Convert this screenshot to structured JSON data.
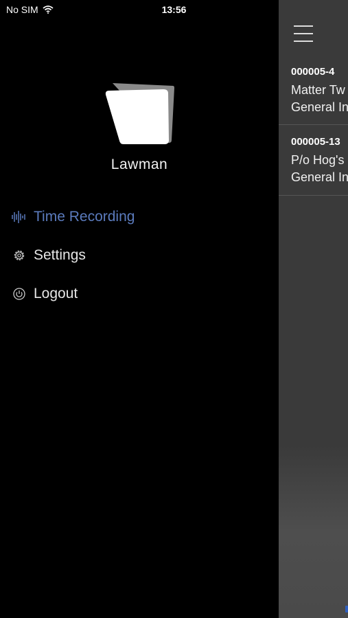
{
  "status_bar": {
    "carrier": "No SIM",
    "time": "13:56"
  },
  "menu": {
    "app_name": "Lawman",
    "items": [
      {
        "label": "Time Recording",
        "icon": "waveform-icon",
        "active": true
      },
      {
        "label": "Settings",
        "icon": "gear-icon"
      },
      {
        "label": "Logout",
        "icon": "power-icon"
      }
    ]
  },
  "list": {
    "rows": [
      {
        "code": "000005-4",
        "line1": "Matter Tw",
        "line2": "General In"
      },
      {
        "code": "000005-13",
        "line1": "P/o Hog's",
        "line2": "General In"
      }
    ]
  },
  "colors": {
    "accent": "#5b7bbd",
    "battery": "#4cd964"
  }
}
